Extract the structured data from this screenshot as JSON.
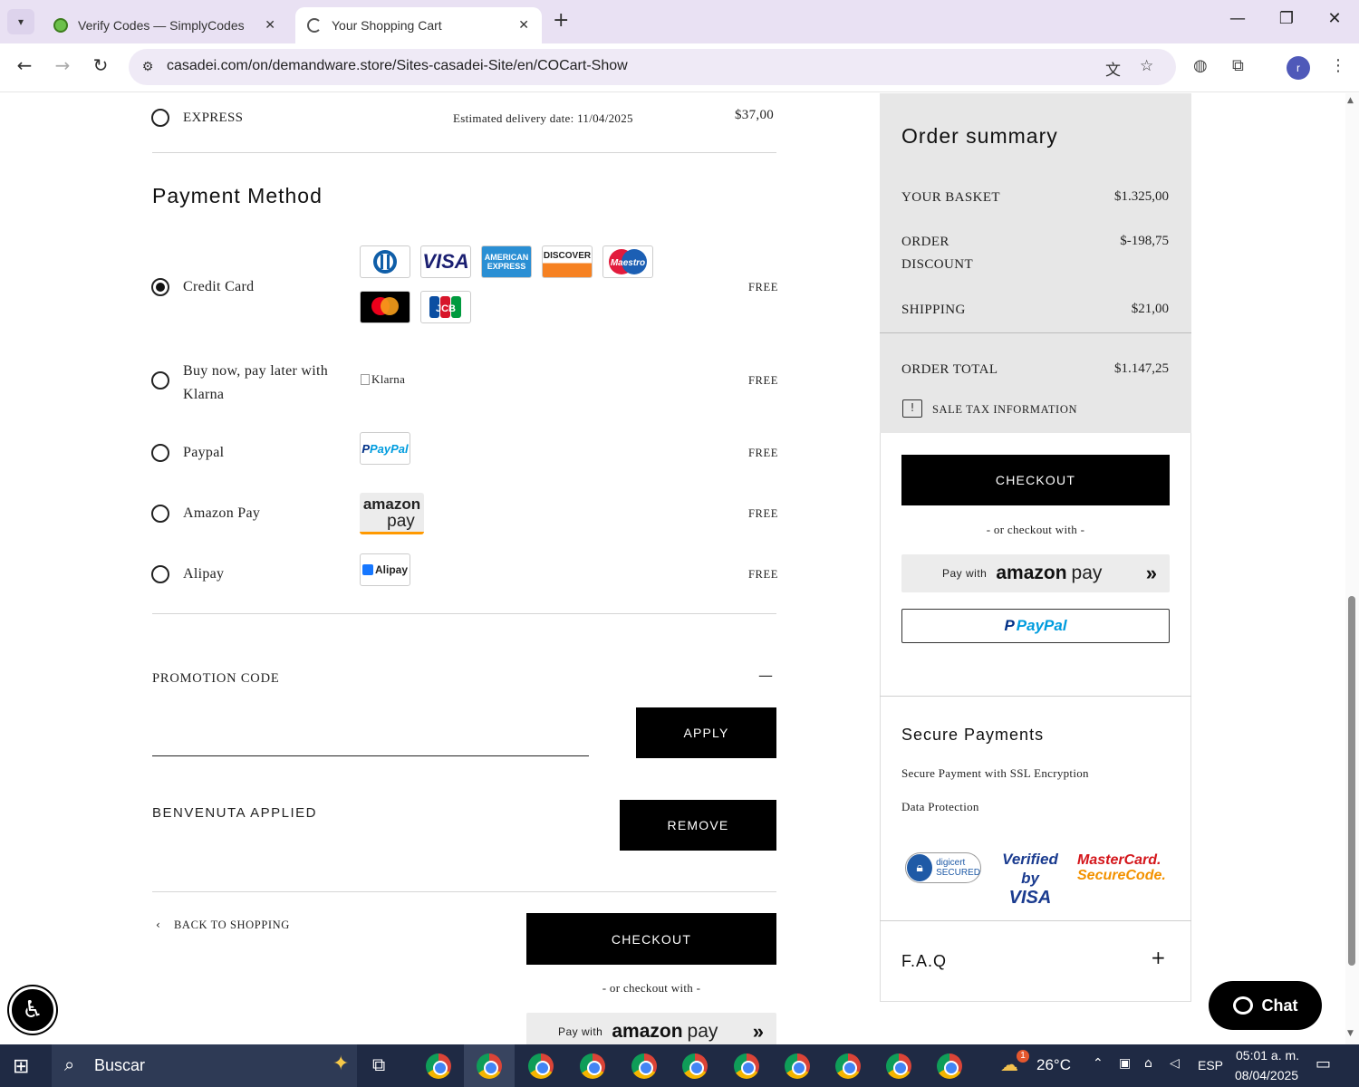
{
  "browser": {
    "tabs": [
      {
        "title": "Verify Codes — SimplyCodes",
        "active": false
      },
      {
        "title": "Your Shopping Cart",
        "active": true
      }
    ],
    "url": "casadei.com/on/demandware.store/Sites-casadei-Site/en/COCart-Show",
    "profile_initial": "r"
  },
  "shipping": {
    "option_label": "EXPRESS",
    "delivery": "Estimated delivery date: 11/04/2025",
    "price": "$37,00"
  },
  "payment": {
    "title": "Payment Method",
    "methods": [
      {
        "label": "Credit Card",
        "fee": "FREE",
        "selected": true
      },
      {
        "label": "Buy now, pay later with Klarna",
        "fee": "FREE",
        "selected": false,
        "logo_alt": "Klarna"
      },
      {
        "label": "Paypal",
        "fee": "FREE",
        "selected": false
      },
      {
        "label": "Amazon Pay",
        "fee": "FREE",
        "selected": false
      },
      {
        "label": "Alipay",
        "fee": "FREE",
        "selected": false
      }
    ],
    "card_logos": [
      "diners-club",
      "visa",
      "american-express",
      "discover",
      "maestro",
      "mastercard",
      "jcb"
    ],
    "card_text": {
      "visa": "VISA",
      "amex1": "AMERICAN",
      "amex2": "EXPRESS",
      "discover": "DISCOVER",
      "maestro": "Maestro",
      "jcb": "JCB"
    },
    "logos_text": {
      "paypal_p": "P",
      "paypal": "PayPal",
      "amazon": "amazon",
      "pay": "pay",
      "alipay": "Alipay"
    }
  },
  "promotion": {
    "label": "PROMOTION CODE",
    "collapse_icon": "—",
    "input_value": "",
    "apply_label": "APPLY",
    "applied_text": "BENVENUTA APPLIED",
    "remove_label": "REMOVE"
  },
  "footer_actions": {
    "back_label": "BACK TO SHOPPING",
    "checkout_label": "CHECKOUT",
    "or_checkout": "- or checkout with -",
    "amazon_pay_with": "Pay with",
    "amazon_brand": "amazon",
    "amazon_pay": "pay"
  },
  "order_summary": {
    "title": "Order summary",
    "rows": [
      {
        "label": "YOUR BASKET",
        "value": "$1.325,00"
      },
      {
        "label": "ORDER DISCOUNT",
        "value": "$-198,75"
      },
      {
        "label": "SHIPPING",
        "value": "$21,00"
      }
    ],
    "total_label": "ORDER TOTAL",
    "total_value": "$1.147,25",
    "tax_info": "SALE TAX INFORMATION",
    "checkout_label": "CHECKOUT",
    "or_checkout": "- or checkout with -",
    "amazon_pay_with": "Pay with",
    "amazon_brand": "amazon",
    "amazon_pay": "pay",
    "paypal_p": "P",
    "paypal_label": "PayPal"
  },
  "secure_payments": {
    "title": "Secure Payments",
    "items": [
      "Secure Payment with SSL Encryption",
      "Data Protection"
    ],
    "badges": {
      "digicert1": "digicert",
      "digicert2": "SECURED",
      "vbv1": "Verified by",
      "vbv2": "VISA",
      "mc1": "MasterCard.",
      "mc2": "SecureCode."
    }
  },
  "faq": {
    "title": "F.A.Q",
    "toggle": "+"
  },
  "chat": {
    "label": "Chat"
  },
  "taskbar": {
    "search_placeholder": "Buscar",
    "temperature": "26°C",
    "language": "ESP",
    "time": "05:01 a. m.",
    "date": "08/04/2025",
    "weather_badge": "1"
  },
  "colors": {
    "accent": "#000000",
    "summary_bg": "#e7e7e7",
    "tabbar_bg": "#e9e1f3",
    "taskbar_bg": "#1f2a44"
  }
}
